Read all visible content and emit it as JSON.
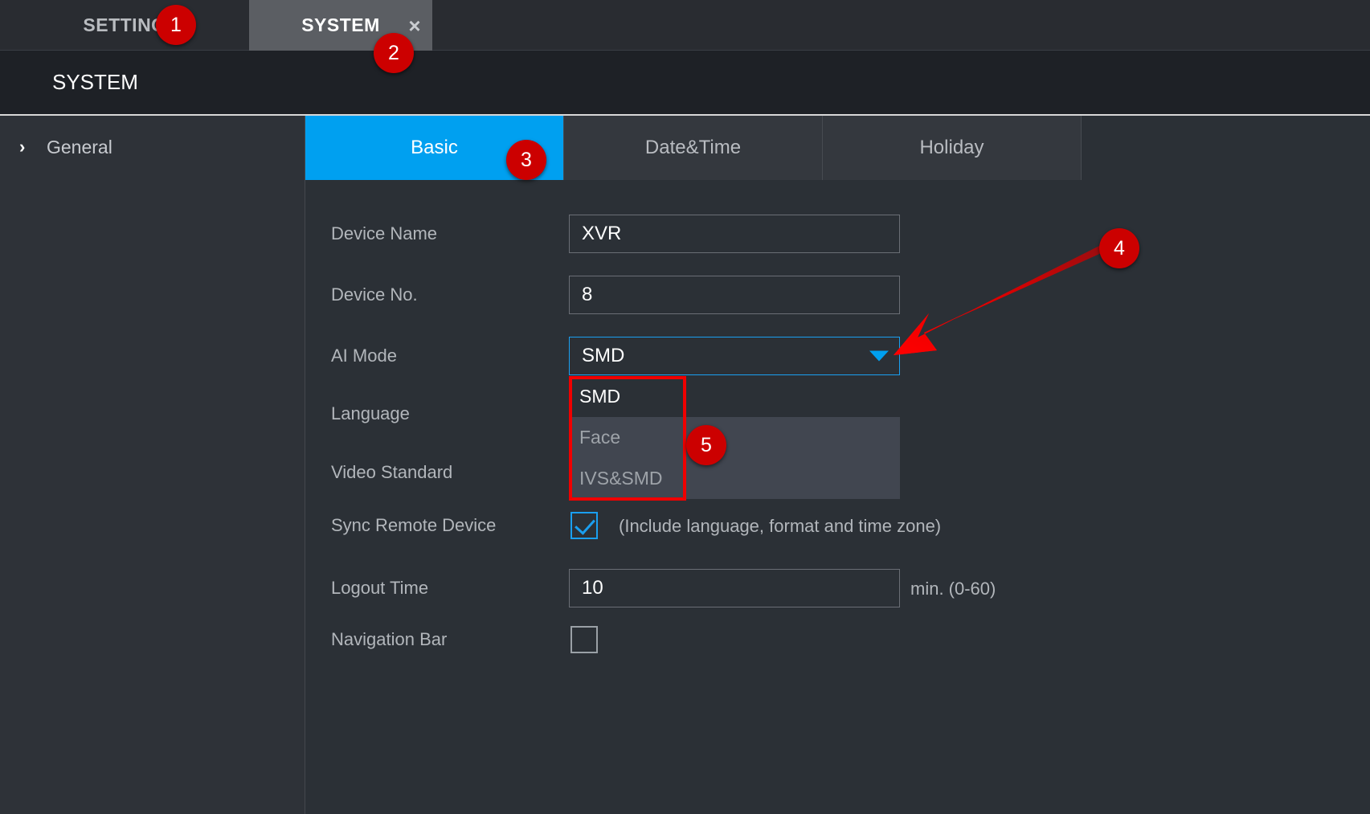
{
  "window": {
    "tabs": [
      {
        "label": "SETTING",
        "active": false
      },
      {
        "label": "SYSTEM",
        "active": true
      }
    ],
    "close_icon": "×"
  },
  "header": {
    "title": "SYSTEM"
  },
  "sidebar": {
    "items": [
      {
        "label": "General",
        "chevron": "›",
        "expanded": false
      }
    ]
  },
  "subtabs": [
    {
      "label": "Basic",
      "active": true
    },
    {
      "label": "Date&Time",
      "active": false
    },
    {
      "label": "Holiday",
      "active": false
    }
  ],
  "form": {
    "device_name": {
      "label": "Device Name",
      "value": "XVR"
    },
    "device_no": {
      "label": "Device No.",
      "value": "8"
    },
    "ai_mode": {
      "label": "AI Mode",
      "value": "SMD",
      "focused": true
    },
    "language": {
      "label": "Language",
      "value": ""
    },
    "video_standard": {
      "label": "Video Standard",
      "value": ""
    },
    "sync_remote_device": {
      "label": "Sync Remote Device",
      "checked": true,
      "hint": "(Include language, format and time zone)"
    },
    "logout_time": {
      "label": "Logout Time",
      "value": "10",
      "hint": "min. (0-60)"
    },
    "navigation_bar": {
      "label": "Navigation Bar",
      "checked": false
    }
  },
  "dropdown": {
    "open": true,
    "options": [
      {
        "label": "SMD",
        "selected": true
      },
      {
        "label": "Face",
        "selected": false
      },
      {
        "label": "IVS&SMD",
        "selected": false
      }
    ]
  },
  "annotations": [
    {
      "id": "1",
      "label": "1"
    },
    {
      "id": "2",
      "label": "2"
    },
    {
      "id": "3",
      "label": "3"
    },
    {
      "id": "4",
      "label": "4"
    },
    {
      "id": "5",
      "label": "5"
    }
  ],
  "colors": {
    "accent": "#00a0f0",
    "annotation": "#cc0000",
    "highlight_box": "#f00000",
    "panel_bg": "#2b3036",
    "titlebar_bg": "#1e2126"
  }
}
